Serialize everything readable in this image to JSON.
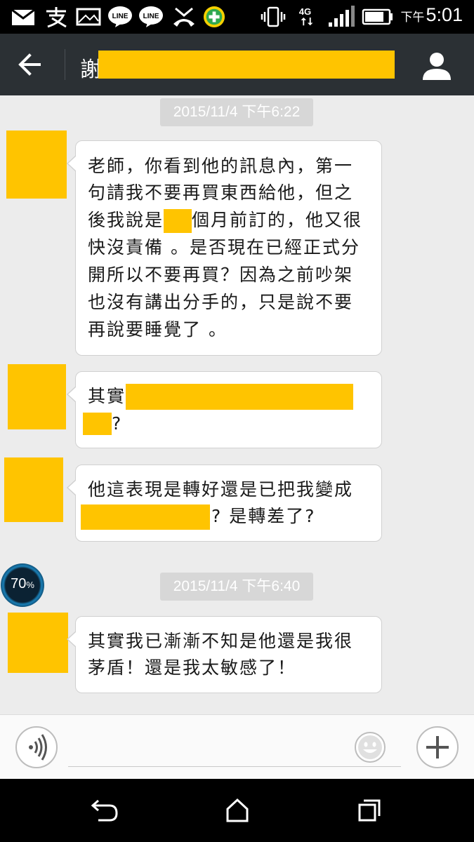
{
  "status_bar": {
    "ampm": "下午",
    "time": "5:01",
    "network": "4G",
    "notification_icons": [
      "mail-icon",
      "alipay-icon",
      "image-icon",
      "line-icon",
      "line-icon",
      "missed-call-icon",
      "plus-app-icon"
    ],
    "system_icons": [
      "vibrate-icon",
      "4g-icon",
      "signal-icon",
      "battery-icon"
    ]
  },
  "header": {
    "title_visible": "謝"
  },
  "messages": [
    {
      "timestamp": "2015/11/4 下午6:22"
    }
  ],
  "bubbles": {
    "b1": {
      "l1": "老師，你看到他的訊息內，第一",
      "l2": "句請我不要再買東西給他，但之",
      "l3a": "後我說是",
      "l3b": "個月前訂的，他又很",
      "l4": "快沒責備 。是否現在已經正式分",
      "l5": "開所以不要再買？因為之前吵架",
      "l6": "也沒有講出分手的，只是說不要",
      "l7": "再說要睡覺了 。"
    },
    "b2": {
      "l1a": "其實",
      "l2b": "?"
    },
    "b3": {
      "l1": "他這表現是轉好還是已把我變成",
      "l2b": "? 是轉差了?"
    },
    "b4": {
      "l1": "其實我已漸漸不知是他還是我很",
      "l2": "茅盾！還是我太敏感了！"
    }
  },
  "timestamps": {
    "t1": "2015/11/4 下午6:22",
    "t2": "2015/11/4 下午6:40"
  },
  "battery_widget": {
    "value": "70",
    "unit": "%"
  },
  "input_bar": {
    "placeholder": "",
    "left_icon": "voice-icon",
    "emoji_icon": "emoji-icon",
    "add_icon": "plus-icon"
  },
  "nav_bar": {
    "icons": [
      "back-nav-icon",
      "home-icon",
      "recents-icon"
    ]
  },
  "colors": {
    "status_bar": "#000000",
    "header": "#2b3034",
    "chat_bg": "#ececec",
    "redaction": "#ffc400",
    "timestamp_bg": "#d7d7d7"
  }
}
